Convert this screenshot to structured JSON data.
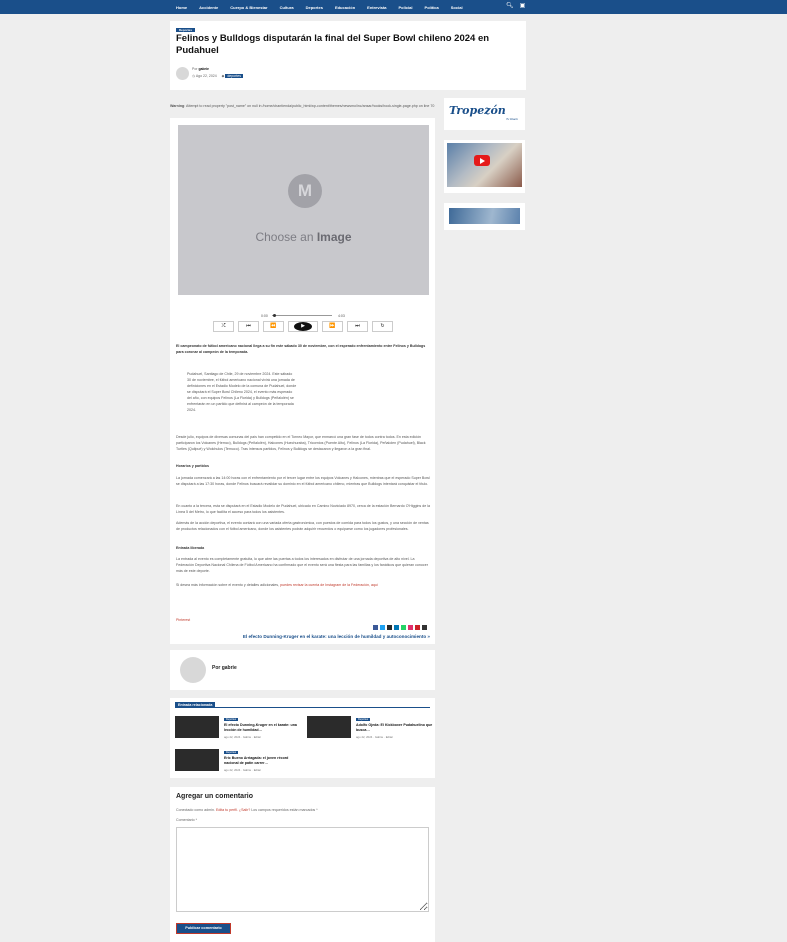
{
  "nav": {
    "items": [
      "Home",
      "Accidente",
      "Cuerpo & Bienestar",
      "Cultura",
      "Deportes",
      "Educación",
      "Entrevista",
      "Policial",
      "Política",
      "Social"
    ],
    "search_icon": "search-icon",
    "screen_icon": "monitor-icon"
  },
  "post": {
    "category": "Deportes",
    "title": "Felinos y Bulldogs disputarán la final del Super Bowl chileno 2024 en Pudahuel",
    "by_label": "Por",
    "author": "gabrie",
    "date": "Ago 22, 2024",
    "tag": "deportes"
  },
  "warning": {
    "label": "Warning",
    "text": ": Attempt to read property \"post_name\" on null in /home/chantienda/public_html/wp-content/themes/newsmo/inc/ansar/hooks/hook-single-page.php on line 70"
  },
  "image": {
    "logo_letter": "M",
    "caption_prefix": "Choose an ",
    "caption_bold": "Image"
  },
  "player": {
    "time_current": "0:00",
    "time_total": "4:03",
    "progress": 0.02,
    "controls": [
      "shuffle-icon",
      "skip-back-icon",
      "rewind-icon",
      "play-icon",
      "forward-icon",
      "skip-forward-icon",
      "repeat-icon"
    ]
  },
  "article": {
    "lead": "El campeonato de fútbol americano nacional llega a su fin este sábado 30 de noviembre, con el esperado enfrentamiento entre Felinos y Bulldogs para coronar al campeón de la temporada.",
    "quote": "Pudahuel, Santiago de Chile, 29 de noviembre 2024. Este sábado 30 de noviembre, el fútbol americano nacional vivirá una jornada de definiciones en el Estadio Modelo de la comuna de Pudahuel, donde se disputará el Super Bowl Chileno 2024, el evento más esperado del año, con equipos Felinos (La Florida) y Bulldogs (Peñalolén) se enfrentarán en un partido que definirá al campeón de la temporada 2024.",
    "p1": "Desde julio, equipos de diversas comunas del país han competido en el Torneo Mayor, que enmarcó una gran fase de todos contra todos. En esta edición participaron los Volcanes (Hemco), Bulldogs (Peñalolén), Halcones (Huechuraba), Tricornios (Puente Alto), Felinos (La Florida), Peñalolen (Pudahuel), Black Turtles (Quilpué) y Wolchulos (Temuco). Tras intensos partidos, Felinos y Bulldogs se destacaron y llegaron a la gran final.",
    "h1": "Horarios y partidos",
    "p2": "La jornada comenzará a las 14:00 horas con el enfrentamiento por el tercer lugar entre los equipos Volcanes y Halcones, mientras que el esperado Super Bowl se disputará a las 17:30 horas, donde Felinos buscará revalidar su dominio en el fútbol americano chileno, mientras que Bulldogs intentará conquistar el título.",
    "p3": "En cuanto a la tercera, esta se disputará en el Estadio Modelo de Pudahuel, ubicado en Camino Noviciado 8970, cerca de la estación Bernardo O'Higgins de la Línea 5 del Metro, lo que facilita el acceso para todos los asistentes.",
    "p4": "Además de la acción deportiva, el evento contará con una variada oferta gastronómica, con puestos de comida para todos los gustos, y una sección de ventas de productos relacionados con el fútbol americano, donde los asistentes podrán adquirir recuerdos o equiparse como los jugadores profesionales.",
    "h2": "Entrada liberada",
    "p5": "La entrada al evento es completamente gratuita, lo que abre las puertas a todos los interesados en disfrutar de una jornada deportiva de alto nivel. La Federación Deportiva Nacional Chilena de Fútbol Americano ha confirmado que el evento será una fiesta para las familias y los fanáticos que quieran conocer más de este deporte.",
    "p6_prefix": "Si desea más información sobre el evento y detalles adicionales, ",
    "p6_link": "puedes revisar la cuenta de Instagram de la Federación, aquí",
    "pinterest": "Pinterest",
    "next_link": "El efecto Dunning-Kruger en el karate: una lección de humildad y autoconocimiento »"
  },
  "share_colors": [
    "#3b5998",
    "#1da1f2",
    "#2a2a2a",
    "#0077b5",
    "#25d366",
    "#e1306c",
    "#cc2127",
    "#333333"
  ],
  "author_box": {
    "label": "Por gabrie"
  },
  "related": {
    "heading": "Entrada relacionada",
    "items": [
      {
        "cat": "Deportes",
        "title": "El efecto Dunning-Kruger en el karate: una lección de humildad…",
        "meta": "ago 22, 2024 · Gabrie · Editar"
      },
      {
        "cat": "Deportes",
        "title": "Adolfo Ojeda: El Kickboxer Pudahuelino que busca…",
        "meta": "ago 22, 2024 · Gabrie · Editar"
      },
      {
        "cat": "Deportes",
        "title": "Eric Bueno Arriagada: el joven récord nacional de patín carrer…",
        "meta": "ago 22, 2024 · Gabrie · Editar"
      }
    ]
  },
  "comment": {
    "title": "Agregar un comentario",
    "note_prefix": "Conectado como admin. ",
    "note_link": "Edita tu perfil. ¿Salir?",
    "note_suffix": " Los campos requeridos están marcados *",
    "label": "Comentario *",
    "submit": "Publicar comentario"
  },
  "sidebar": {
    "logo_text": "Tropezón",
    "logo_sub": "Tu Diario"
  },
  "colors": {
    "primary": "#1a4f8a",
    "accent": "#c0392b",
    "background": "#eeeeee"
  }
}
